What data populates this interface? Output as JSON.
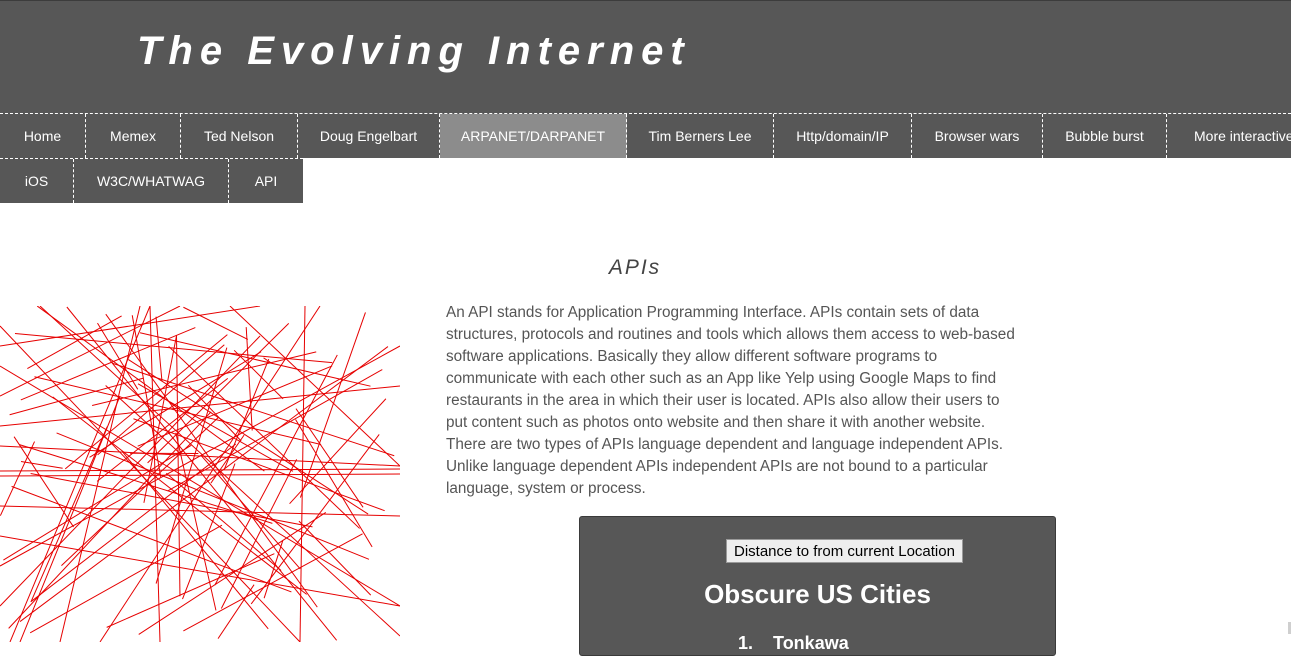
{
  "header": {
    "title": "The Evolving Internet"
  },
  "nav": {
    "row1": [
      {
        "label": "Home",
        "active": false
      },
      {
        "label": "Memex",
        "active": false
      },
      {
        "label": "Ted Nelson",
        "active": false
      },
      {
        "label": "Doug Engelbart",
        "active": false
      },
      {
        "label": "ARPANET/DARPANET",
        "active": true
      },
      {
        "label": "Tim Berners Lee",
        "active": false
      },
      {
        "label": "Http/domain/IP",
        "active": false
      },
      {
        "label": "Browser wars",
        "active": false
      },
      {
        "label": "Bubble burst",
        "active": false
      },
      {
        "label": "More interactive w",
        "active": false
      }
    ],
    "row2": [
      {
        "label": "iOS",
        "active": false
      },
      {
        "label": "W3C/WHATWAG",
        "active": false
      },
      {
        "label": "API",
        "active": false
      }
    ]
  },
  "main": {
    "heading": "APIs",
    "paragraph": "An API stands for Application Programming Interface. APIs contain sets of data structures, protocols and routines and tools which allows them access to web-based software applications. Basically they allow different software programs to communicate with each other such as an App like Yelp using Google Maps to find restaurants in the area in which their user is located. APIs also allow their users to put content such as photos onto website and then share it with another website. There are two types of APIs language dependent and language independent APIs. Unlike language dependent APIs independent APIs are not bound to a particular language, system or process."
  },
  "panel": {
    "button_label": "Distance to from current Location",
    "title": "Obscure US Cities",
    "list": [
      {
        "number": "1.",
        "name": "Tonkawa"
      }
    ]
  },
  "colors": {
    "header_bg": "#575757",
    "nav_active_bg": "#8c8c8c",
    "art_line": "#e60000"
  }
}
